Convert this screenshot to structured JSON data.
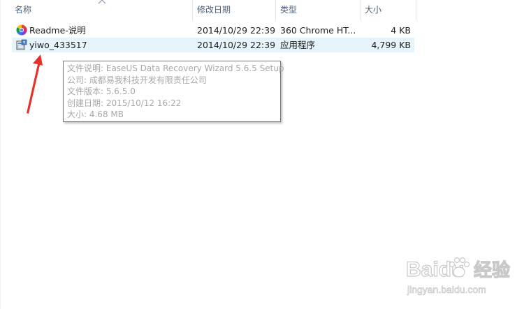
{
  "columns": {
    "name": "名称",
    "modified": "修改日期",
    "type": "类型",
    "size": "大小"
  },
  "files": [
    {
      "name": "Readme-说明",
      "modified": "2014/10/29 22:39",
      "type": "360 Chrome HT...",
      "size": "4 KB",
      "icon": "chrome-browser-icon",
      "selected": false
    },
    {
      "name": "yiwo_433517",
      "modified": "2014/10/29 22:39",
      "type": "应用程序",
      "size": "4,799 KB",
      "icon": "installer-app-icon",
      "selected": true
    }
  ],
  "tooltip": {
    "description": "文件说明: EaseUS Data Recovery Wizard 5.6.5 Setup",
    "company": "公司: 成都易我科技开发有限责任公司",
    "version": "文件版本: 5.6.5.0",
    "created": "创建日期: 2015/10/12 16:22",
    "size": "大小: 4.68 MB"
  },
  "watermark": {
    "brand": "Baidu",
    "brand_suffix": "经验",
    "url": "jingyan.baidu.com"
  },
  "colors": {
    "header_text": "#4c607a",
    "selection": "#e5f3fb",
    "tooltip_text": "#a8a8a8",
    "annotation": "#e8302a"
  }
}
